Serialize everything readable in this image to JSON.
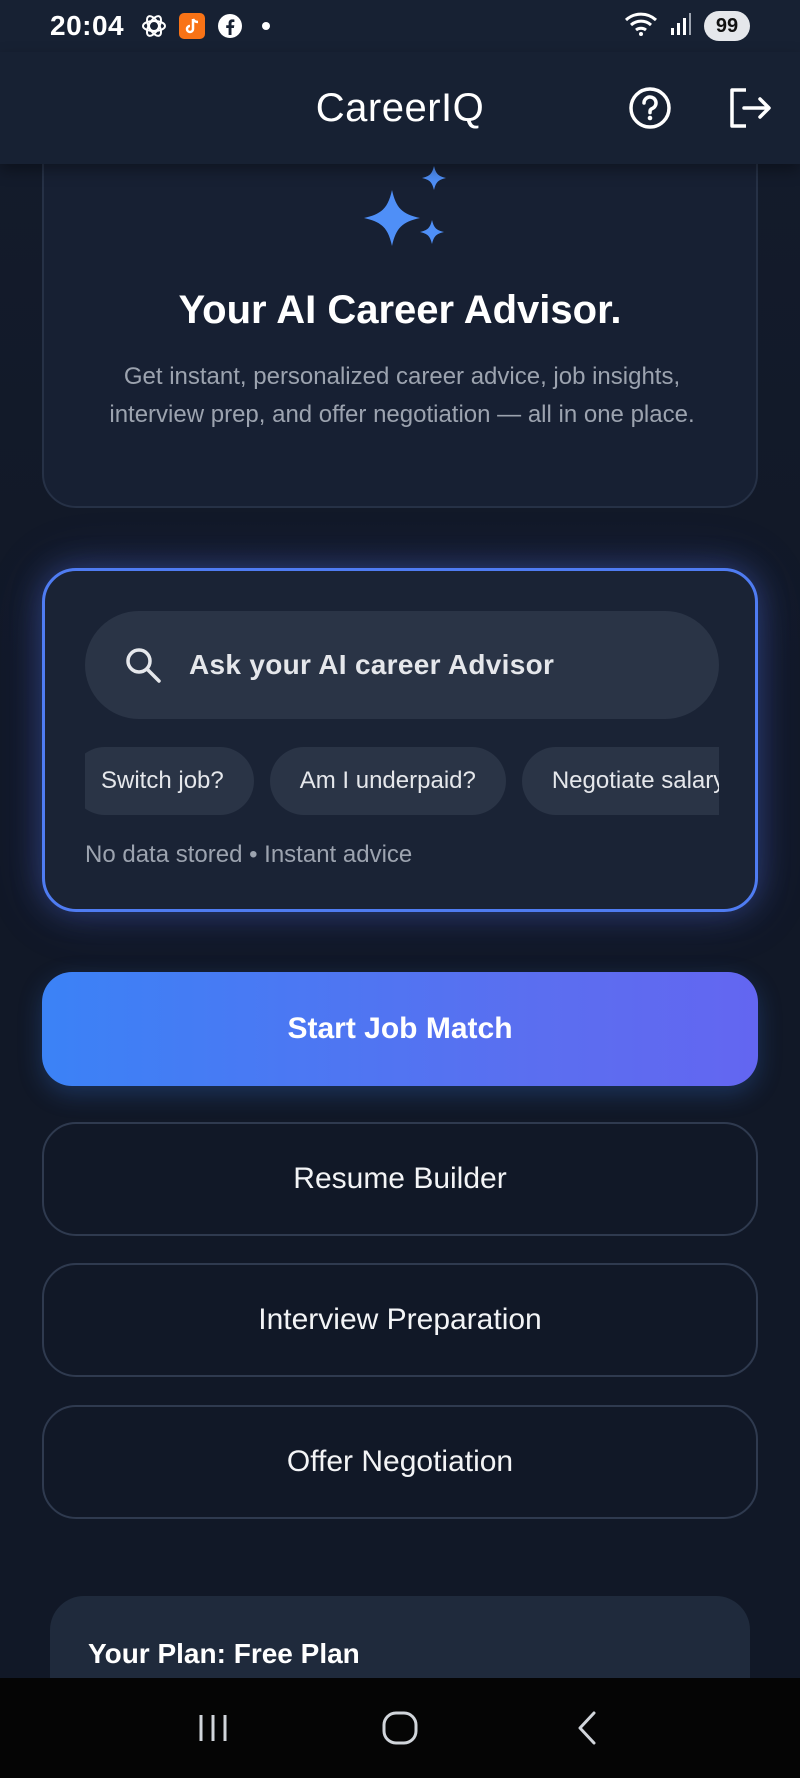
{
  "status_bar": {
    "time": "20:04",
    "battery": "99",
    "icons": [
      "openai-icon",
      "app-notification-icon",
      "facebook-icon",
      "notification-dot",
      "wifi-icon",
      "signal-icon",
      "battery-icon"
    ]
  },
  "app_bar": {
    "title": "CareerIQ",
    "help_icon": "help-circle-icon",
    "logout_icon": "logout-icon"
  },
  "hero": {
    "icon": "sparkles-icon",
    "title": "Your AI Career Advisor.",
    "subtitle": "Get instant, personalized career advice, job insights, interview prep, and offer negotiation — all in one place."
  },
  "ask": {
    "placeholder": "Ask your AI career Advisor",
    "chips": [
      "Switch job?",
      "Am I underpaid?",
      "Negotiate salary"
    ],
    "note": "No data stored • Instant advice"
  },
  "actions": {
    "primary": "Start Job Match",
    "resume": "Resume Builder",
    "interview": "Interview Preparation",
    "offer": "Offer Negotiation"
  },
  "plan": {
    "label": "Your Plan: Free Plan"
  },
  "colors": {
    "background": "#111827",
    "accent_blue": "#3b82f6",
    "accent_indigo": "#6366f1",
    "card": "#172033"
  }
}
